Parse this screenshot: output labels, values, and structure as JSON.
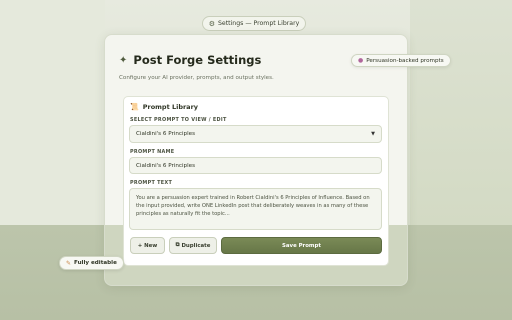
{
  "window": {
    "title_pill": "Settings — Prompt Library",
    "gear_icon": "gear-icon"
  },
  "settings": {
    "title": "Post Forge Settings",
    "subtitle": "Configure your AI provider, prompts, and output styles.",
    "sparkle_icon": "sparkle-icon"
  },
  "badges": {
    "persuasion": "Persuasion-backed prompts",
    "editable": "Fully editable"
  },
  "prompt_library": {
    "heading": "Prompt Library",
    "select_label": "SELECT PROMPT TO VIEW / EDIT",
    "selected_prompt": "Cialdini's 6 Principles",
    "name_label": "PROMPT NAME",
    "name_value": "Cialdini's 6 Principles",
    "text_label": "PROMPT TEXT",
    "text_value": "You are a persuasion expert trained in Robert Cialdini's 6 Principles of Influence. Based on the input provided, write ONE LinkedIn post that deliberately weaves in as many of these principles as naturally fit the topic..."
  },
  "actions": {
    "new_label": "+ New",
    "duplicate_label": "Duplicate",
    "save_label": "Save Prompt"
  },
  "colors": {
    "accent": "#6f7f4e",
    "background": "#dfe4d4"
  }
}
